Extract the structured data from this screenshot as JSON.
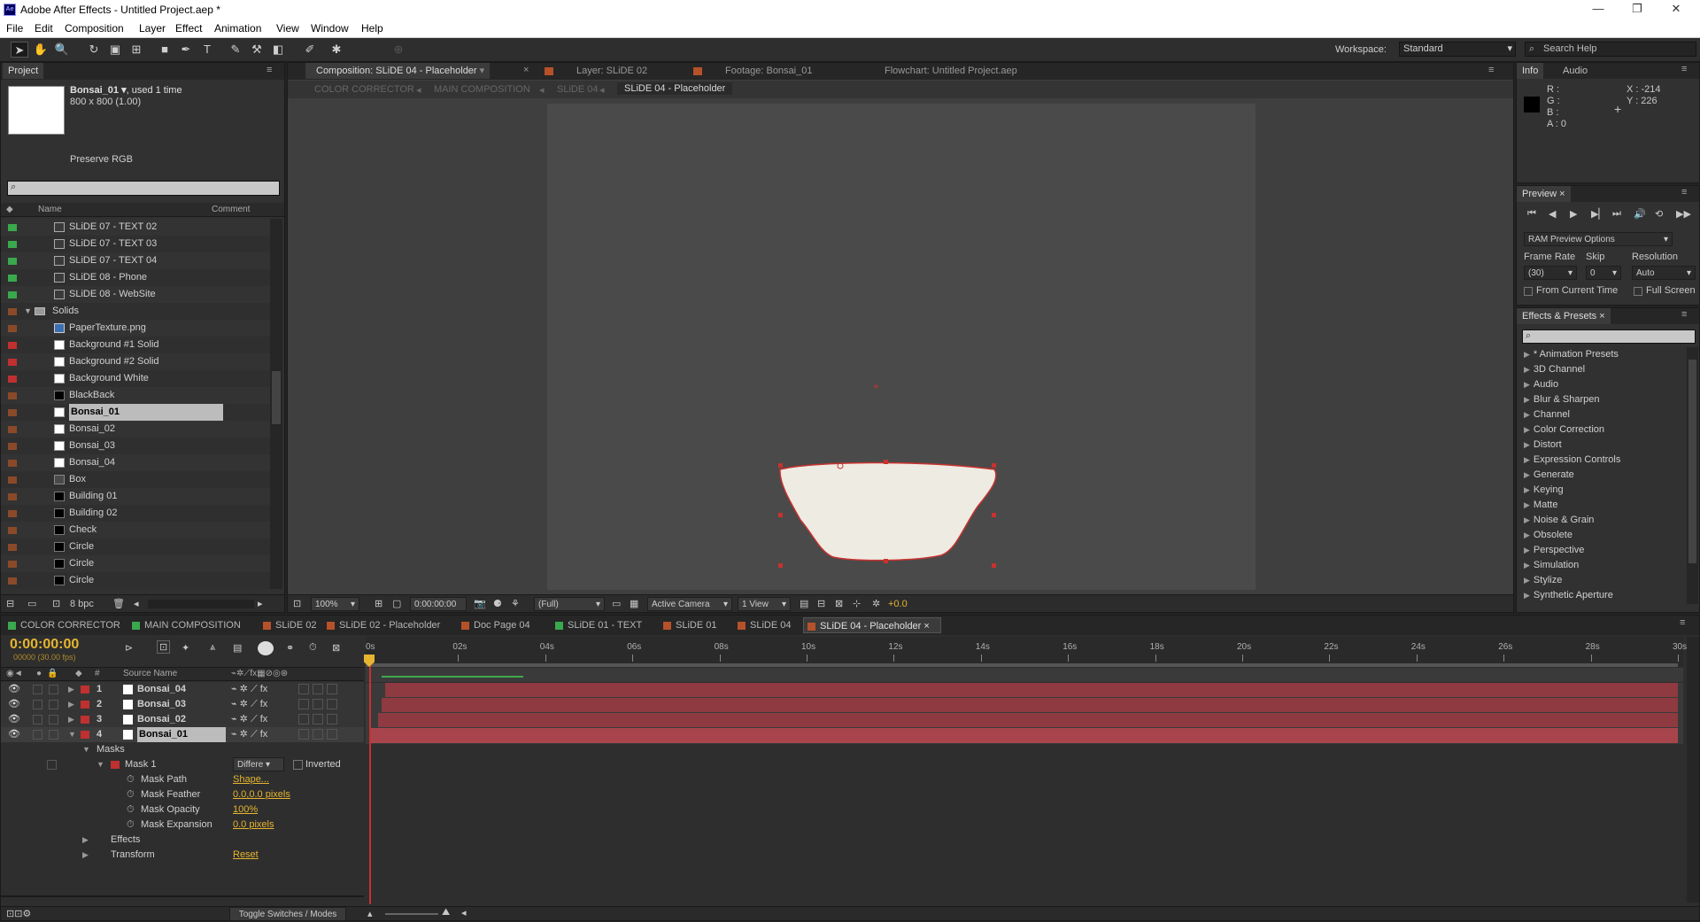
{
  "window": {
    "title": "Adobe After Effects - Untitled Project.aep *",
    "minimize": "—",
    "restore": "❐",
    "close": "✕"
  },
  "menu": [
    "File",
    "Edit",
    "Composition",
    "Layer",
    "Effect",
    "Animation",
    "View",
    "Window",
    "Help"
  ],
  "workspace": {
    "label": "Workspace:",
    "value": "Standard"
  },
  "search_help": "Search Help",
  "project": {
    "tab": "Project",
    "item_name": "Bonsai_01 ▾",
    "item_used": ", used 1 time",
    "item_dims": "800 x 800 (1.00)",
    "preserve": "Preserve RGB",
    "col_name": "Name",
    "col_comment": "Comment",
    "bpc": "8 bpc",
    "items": [
      {
        "name": "SLiDE 07 - TEXT 02",
        "color": "#3aa84c",
        "icon": "comp",
        "indent": 2
      },
      {
        "name": "SLiDE 07 - TEXT 03",
        "color": "#3aa84c",
        "icon": "comp",
        "indent": 2
      },
      {
        "name": "SLiDE 07 - TEXT 04",
        "color": "#3aa84c",
        "icon": "comp",
        "indent": 2
      },
      {
        "name": "SLiDE 08 - Phone",
        "color": "#3aa84c",
        "icon": "comp",
        "indent": 2
      },
      {
        "name": "SLiDE 08 - WebSite",
        "color": "#3aa84c",
        "icon": "comp",
        "indent": 2
      },
      {
        "name": "Solids",
        "color": "#8a4a2a",
        "icon": "folder",
        "indent": 1
      },
      {
        "name": "PaperTexture.png",
        "color": "#8a4a2a",
        "icon": "png",
        "indent": 2
      },
      {
        "name": "Background #1 Solid",
        "color": "#c03030",
        "icon": "white",
        "indent": 2
      },
      {
        "name": "Background #2 Solid",
        "color": "#c03030",
        "icon": "white",
        "indent": 2
      },
      {
        "name": "Background White",
        "color": "#c03030",
        "icon": "white",
        "indent": 2
      },
      {
        "name": "BlackBack",
        "color": "#8a4a2a",
        "icon": "black",
        "indent": 2
      },
      {
        "name": "Bonsai_01",
        "color": "#8a4a2a",
        "icon": "white",
        "indent": 2,
        "selected": true
      },
      {
        "name": "Bonsai_02",
        "color": "#8a4a2a",
        "icon": "white",
        "indent": 2
      },
      {
        "name": "Bonsai_03",
        "color": "#8a4a2a",
        "icon": "white",
        "indent": 2
      },
      {
        "name": "Bonsai_04",
        "color": "#8a4a2a",
        "icon": "white",
        "indent": 2
      },
      {
        "name": "Box",
        "color": "#8a4a2a",
        "icon": "grey",
        "indent": 2
      },
      {
        "name": "Building 01",
        "color": "#8a4a2a",
        "icon": "black",
        "indent": 2
      },
      {
        "name": "Building 02",
        "color": "#8a4a2a",
        "icon": "black",
        "indent": 2
      },
      {
        "name": "Check",
        "color": "#8a4a2a",
        "icon": "black",
        "indent": 2
      },
      {
        "name": "Circle",
        "color": "#8a4a2a",
        "icon": "black",
        "indent": 2
      },
      {
        "name": "Circle",
        "color": "#8a4a2a",
        "icon": "black",
        "indent": 2
      },
      {
        "name": "Circle",
        "color": "#8a4a2a",
        "icon": "black",
        "indent": 2
      }
    ]
  },
  "viewer_tabs": {
    "comp": "Composition: SLiDE 04 - Placeholder",
    "layer": "Layer: SLiDE 02",
    "footage": "Footage: Bonsai_01",
    "flowchart": "Flowchart: Untitled Project.aep"
  },
  "breadcrumbs": [
    "COLOR CORRECTOR",
    "MAIN COMPOSITION",
    "SLiDE 04",
    "SLiDE 04 - Placeholder"
  ],
  "viewer_controls": {
    "zoom": "100%",
    "timecode": "0:00:00:00",
    "resolution": "(Full)",
    "camera": "Active Camera",
    "view": "1 View",
    "exposure": "+0.0"
  },
  "info": {
    "tab": "Info",
    "tab2": "Audio",
    "r": "R :",
    "g": "G :",
    "b": "B :",
    "a": "A : 0",
    "x": "X : -214",
    "y": "Y : 226"
  },
  "preview": {
    "tab": "Preview",
    "ram": "RAM Preview Options",
    "frame_rate_label": "Frame Rate",
    "skip_label": "Skip",
    "resolution_label": "Resolution",
    "frame_rate": "(30)",
    "skip": "0",
    "resolution": "Auto",
    "from_current": "From Current Time",
    "full_screen": "Full Screen"
  },
  "effects": {
    "tab": "Effects & Presets",
    "items": [
      "* Animation Presets",
      "3D Channel",
      "Audio",
      "Blur & Sharpen",
      "Channel",
      "Color Correction",
      "Distort",
      "Expression Controls",
      "Generate",
      "Keying",
      "Matte",
      "Noise & Grain",
      "Obsolete",
      "Perspective",
      "Simulation",
      "Stylize",
      "Synthetic Aperture"
    ]
  },
  "comp_tabs": [
    {
      "label": "COLOR CORRECTOR",
      "color": "#3aa84c"
    },
    {
      "label": "MAIN COMPOSITION",
      "color": "#3aa84c"
    },
    {
      "label": "SLiDE 02",
      "color": "#b5522a"
    },
    {
      "label": "SLiDE 02 - Placeholder",
      "color": "#b5522a"
    },
    {
      "label": "Doc Page 04",
      "color": "#b5522a"
    },
    {
      "label": "SLiDE 01 - TEXT",
      "color": "#3aa84c"
    },
    {
      "label": "SLiDE 01",
      "color": "#b5522a"
    },
    {
      "label": "SLiDE 04",
      "color": "#b5522a"
    },
    {
      "label": "SLiDE 04 - Placeholder",
      "color": "#b5522a",
      "active": true
    }
  ],
  "timeline": {
    "timecode": "0:00:00:00",
    "fps": "00000 (30.00 fps)",
    "col_source": "Source Name",
    "ticks": [
      "0s",
      "02s",
      "04s",
      "06s",
      "08s",
      "10s",
      "12s",
      "14s",
      "16s",
      "18s",
      "20s",
      "22s",
      "24s",
      "26s",
      "28s",
      "30s"
    ],
    "layers": [
      {
        "num": "1",
        "name": "Bonsai_04"
      },
      {
        "num": "2",
        "name": "Bonsai_03"
      },
      {
        "num": "3",
        "name": "Bonsai_02"
      },
      {
        "num": "4",
        "name": "Bonsai_01",
        "selected": true
      }
    ],
    "masks": "Masks",
    "mask1": "Mask 1",
    "mask_mode": "Differe",
    "inverted": "Inverted",
    "props": [
      {
        "name": "Mask Path",
        "value": "Shape..."
      },
      {
        "name": "Mask Feather",
        "value": "0.0,0.0 pixels"
      },
      {
        "name": "Mask Opacity",
        "value": "100%"
      },
      {
        "name": "Mask Expansion",
        "value": "0.0 pixels"
      }
    ],
    "effects": "Effects",
    "transform": "Transform",
    "reset": "Reset",
    "toggle": "Toggle Switches / Modes"
  },
  "colors": {
    "accent": "#e6b530",
    "layer_bar": "#8e3a40",
    "mask": "#c8322e"
  }
}
